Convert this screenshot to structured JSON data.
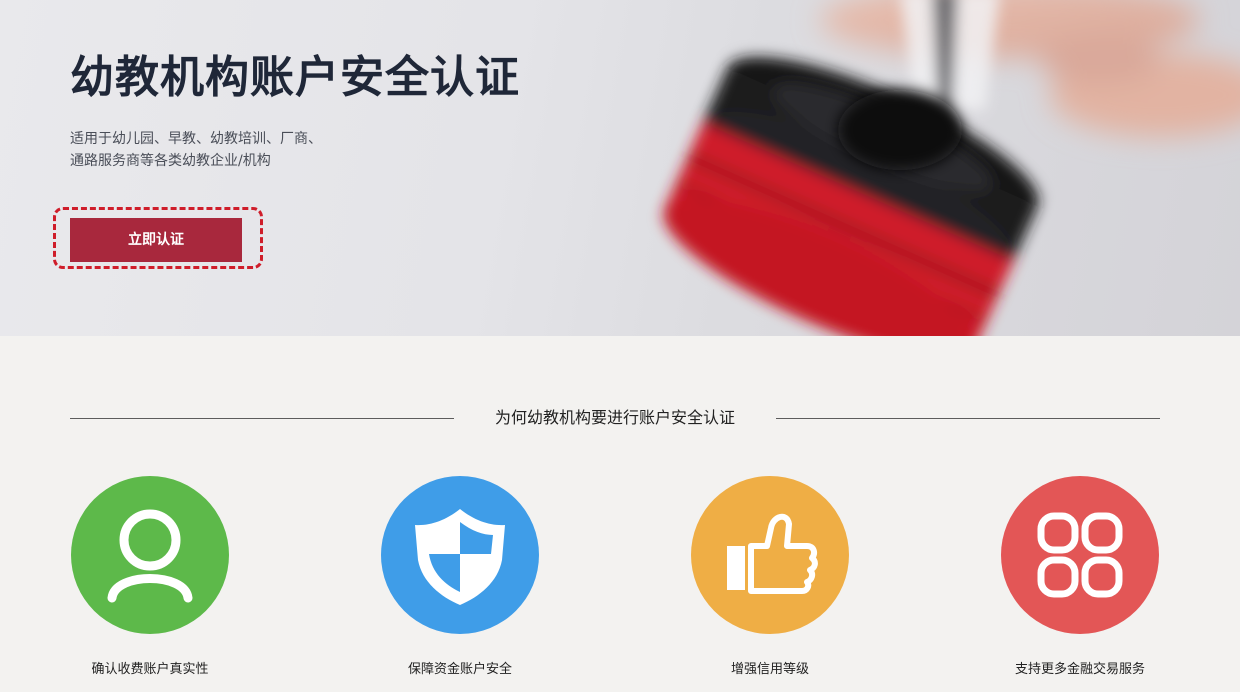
{
  "hero": {
    "title": "幼教机构账户安全认证",
    "subtitle_line1": "适用于幼儿园、早教、幼教培训、厂商、",
    "subtitle_line2": "通路服务商等各类幼教企业/机构",
    "cta_label": "立即认证",
    "cta_color": "#a8283d",
    "cta_highlight_color": "#cf1d2a"
  },
  "section": {
    "title": "为何幼教机构要进行账户安全认证",
    "features": [
      {
        "label": "确认收费账户真实性",
        "icon": "user-icon",
        "color": "#5db94a"
      },
      {
        "label": "保障资金账户安全",
        "icon": "shield-icon",
        "color": "#3f9de8"
      },
      {
        "label": "增强信用等级",
        "icon": "thumbs-up-icon",
        "color": "#efae45"
      },
      {
        "label": "支持更多金融交易服务",
        "icon": "apps-grid-icon",
        "color": "#e35656"
      }
    ]
  }
}
